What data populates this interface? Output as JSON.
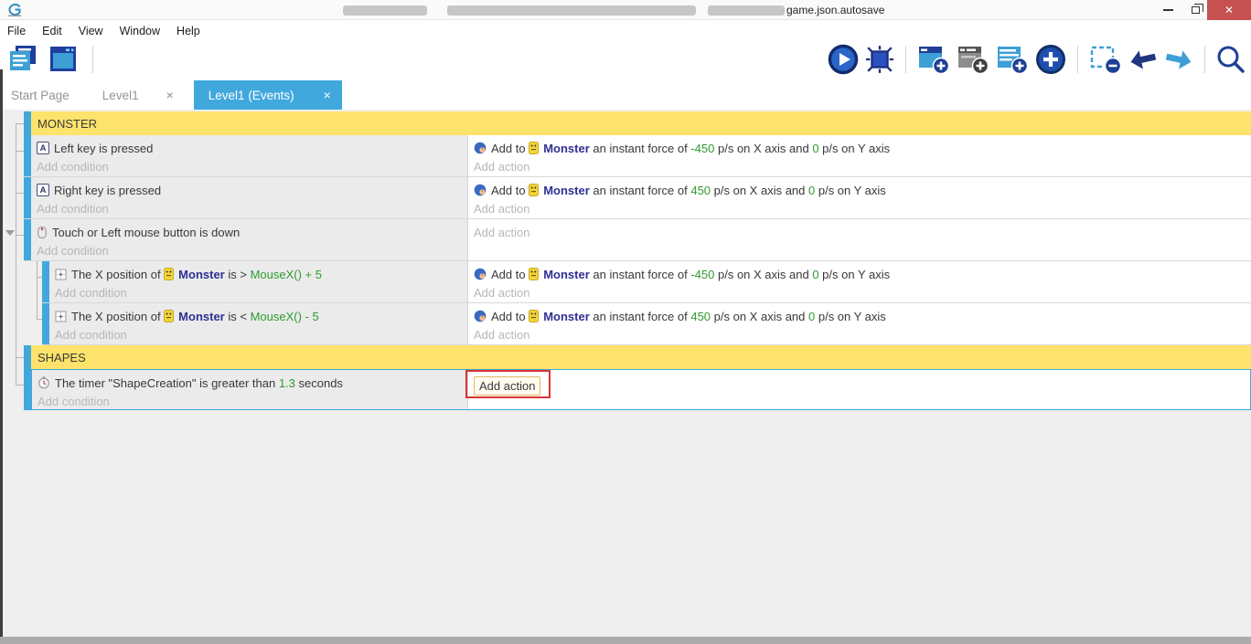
{
  "window": {
    "title_visible": "game.json.autosave",
    "close_glyph": "✕"
  },
  "menu": {
    "items": [
      "File",
      "Edit",
      "View",
      "Window",
      "Help"
    ]
  },
  "tabs": {
    "start_page": "Start Page",
    "level1": "Level1",
    "level1_close": "×",
    "events_tab": "Level1 (Events)",
    "events_tab_close": "×"
  },
  "groups": {
    "monster": "MONSTER",
    "shapes": "SHAPES"
  },
  "placeholders": {
    "condition": "Add condition",
    "action": "Add action"
  },
  "icons": {
    "keyboard_glyph": "A"
  },
  "colors": {
    "accent_blue": "#41a8dd",
    "group_yellow": "#fde36b",
    "object_navy": "#2f2f94",
    "value_green": "#2e9b2e",
    "annotation_red": "#dd3333",
    "close_red": "#c75050"
  },
  "events": {
    "e1": {
      "condition": "Left key is pressed",
      "action": {
        "prefix": "Add to ",
        "object": "Monster",
        "mid1": " an instant force of ",
        "x": "-450",
        "mid2": " p/s on X axis and ",
        "y": "0",
        "suffix": " p/s on Y axis"
      }
    },
    "e2": {
      "condition": "Right key is pressed",
      "action": {
        "prefix": "Add to ",
        "object": "Monster",
        "mid1": " an instant force of ",
        "x": "450",
        "mid2": " p/s on X axis and ",
        "y": "0",
        "suffix": " p/s on Y axis"
      }
    },
    "e3": {
      "condition": "Touch or Left mouse button is down"
    },
    "s1": {
      "condition": {
        "pre": "The X position of ",
        "object": "Monster",
        "mid": " is ",
        "op": "> ",
        "expr": "MouseX() + 5"
      },
      "action": {
        "prefix": "Add to ",
        "object": "Monster",
        "mid1": " an instant force of ",
        "x": "-450",
        "mid2": " p/s on X axis and ",
        "y": "0",
        "suffix": " p/s on Y axis"
      }
    },
    "s2": {
      "condition": {
        "pre": "The X position of ",
        "object": "Monster",
        "mid": " is ",
        "op": "< ",
        "expr": "MouseX() - 5"
      },
      "action": {
        "prefix": "Add to ",
        "object": "Monster",
        "mid1": " an instant force of ",
        "x": "450",
        "mid2": " p/s on X axis and ",
        "y": "0",
        "suffix": " p/s on Y axis"
      }
    },
    "t1": {
      "condition": {
        "pre": "The timer \"ShapeCreation\" is greater than ",
        "value": "1.3",
        "suffix": " seconds"
      }
    }
  }
}
